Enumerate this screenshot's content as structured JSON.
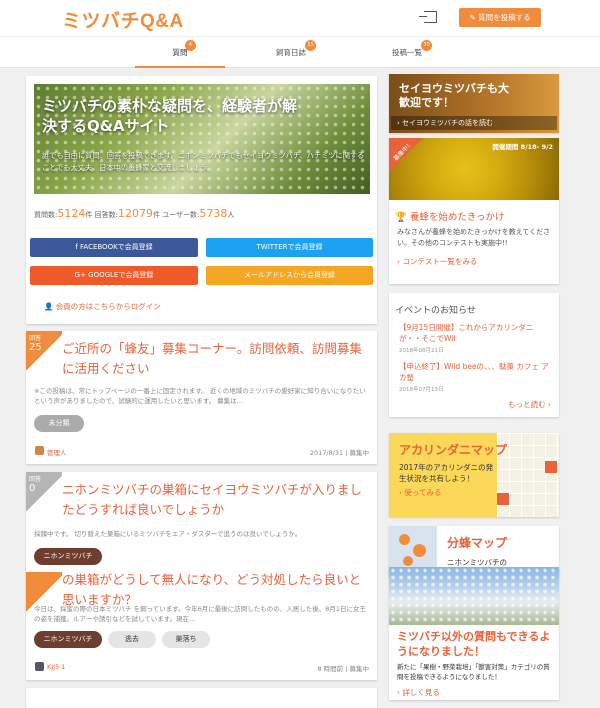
{
  "header": {
    "logo": "ミツバチQ&A",
    "post_button": "質問を投稿する"
  },
  "tabs": [
    {
      "label": "質問",
      "badge": "4"
    },
    {
      "label": "飼育日誌",
      "badge": "15"
    },
    {
      "label": "投稿一覧",
      "badge": "30"
    }
  ],
  "hero": {
    "title": "ミツバチの素朴な疑問を、経験者が解決するQ&Aサイト",
    "desc": "誰でも自由に質問、回答を投稿できます。ニホンミツバチでもセイヨウミツバチ、ハチミツに関することでも大丈夫。日本中の養蜂家と交流しましょう。"
  },
  "stats": {
    "q_label": "質問数:",
    "q_value": "5124",
    "q_unit": "件",
    "a_label": "回答数:",
    "a_value": "12079",
    "a_unit": "件",
    "u_label": "ユーザー数:",
    "u_value": "5738",
    "u_unit": "人"
  },
  "signup": {
    "facebook": "f FACEBOOKで会員登録",
    "twitter": "TWITTERで会員登録",
    "google": "G+ GOOGLEで会員登録",
    "email": "メールアドレスから会員登録",
    "member_login": "会員の方はこちらからログイン"
  },
  "questions": [
    {
      "ribbon_label": "回答",
      "answers": "25",
      "title": "ご近所の「蜂友」募集コーナー。訪問依頼、訪問募集に活用ください",
      "excerpt": "※この投稿は、常にトップページの一番上に固定されます。 近くの地域のミツバチの愛好家に知り合いになりたいという声がありましたので、試験的に運用したいと思います。 募集は...",
      "tags": [
        "未分類"
      ],
      "user": "管理人",
      "date": "2017/8/31",
      "status": "募集中"
    },
    {
      "ribbon_label": "回答",
      "answers": "0",
      "title": "ニホンミツバチの巣箱にセイヨウミツバチが入りましたどうすれば良いでしょうか",
      "excerpt": "採餌中です。 切り替えた巣箱にいるミツバチをエア・ダスターで追うのは良いでしょうか。",
      "tags": [
        "ニホンミツバチ"
      ]
    },
    {
      "ribbon_label": "回答",
      "title": "の巣箱がどうして無人になり、どう対処したら良いと思いますか？",
      "excerpt": "今日は、採蜜の際の日本ミツバチ を飼っています。今年6月に最後に訪問したものの、入居した後、8月1日に女王の姿を捕獲。ルアーや誘引などを試しています。現在...",
      "tags": [
        "ニホンミツバチ",
        "逃去",
        "巣落ち"
      ],
      "user": "KJJ5 1",
      "date": "8 時間前",
      "status": "募集中"
    }
  ],
  "sidebar": {
    "western_bee_banner": {
      "title": "セイヨウミツバチも大歓迎です！",
      "link": "セイヨウミツバチの話を読む"
    },
    "contest": {
      "badge": "募集中！",
      "period": "開催期間 8/18- 9/2",
      "title": "養蜂を始めたきっかけ",
      "desc": "みなさんが養蜂を始めたきっかけを教えてください。その他のコンテストも実施中!!",
      "link": "コンテスト一覧をみる"
    },
    "events": {
      "title": "イベントのお知らせ",
      "items": [
        {
          "title": "【9月15日開催】これからアカリンダニが・・そこでWil",
          "date": "2018年08月21日"
        },
        {
          "title": "【申込終了】Wild beeの、、、駄菓 カフェ アカ塾",
          "date": "2018年07月13日"
        }
      ],
      "more": "もっと読む"
    },
    "acarine_map": {
      "title": "アカリンダニマップ",
      "desc": "2017年のアカリンダニの発生状況を共有しよう！",
      "link": "使ってみる"
    },
    "swarm_map": {
      "title": "分蜂マップ",
      "desc": "ニホンミツバチの"
    },
    "other_questions": {
      "title": "ミツバチ以外の質問もできるようになりました！",
      "desc": "新たに「果樹・野菜栽培」「獣害対策」カテゴリの質問を投稿できるようになりました！",
      "link": "詳しく見る"
    }
  },
  "colors": {
    "accent": "#f08c3c",
    "link": "#e8623a",
    "facebook": "#3b5998",
    "twitter": "#1da1f2",
    "google": "#f05a28",
    "email": "#f5a623"
  },
  "icons": [
    "login-icon",
    "pencil-icon",
    "user-icon",
    "trophy-icon",
    "chevron-right-icon",
    "facebook-icon",
    "twitter-icon",
    "google-icon",
    "mail-icon"
  ]
}
